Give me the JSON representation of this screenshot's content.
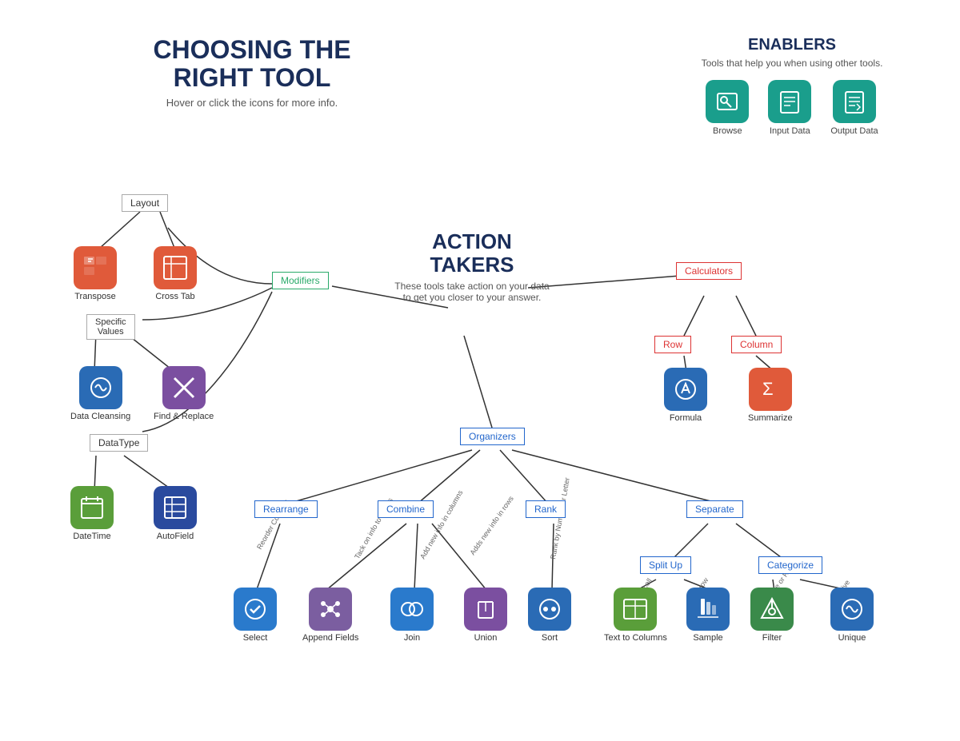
{
  "title": {
    "heading": "CHOOSING THE RIGHT TOOL",
    "subtitle": "Hover or click the icons for more info."
  },
  "enablers": {
    "heading": "ENABLERS",
    "description": "Tools that help you when using other tools.",
    "tools": [
      {
        "label": "Browse",
        "color": "teal",
        "icon": "🔭"
      },
      {
        "label": "Input Data",
        "color": "teal",
        "icon": "📖"
      },
      {
        "label": "Output Data",
        "color": "teal",
        "icon": "📋"
      }
    ]
  },
  "action_takers": {
    "heading": "ACTION TAKERS",
    "description": "These tools take action on your data to get you closer to your answer."
  },
  "categories": {
    "modifiers": "Modifiers",
    "organizers": "Organizers",
    "layout": "Layout",
    "specific_values": "Specific Values",
    "data_type": "DataType",
    "calculators": "Calculators",
    "row": "Row",
    "column": "Column",
    "rearrange": "Rearrange",
    "combine": "Combine",
    "rank": "Rank",
    "separate": "Separate",
    "split_up": "Split Up",
    "categorize": "Categorize"
  },
  "tools": {
    "transpose": "Transpose",
    "cross_tab": "Cross Tab",
    "data_cleansing": "Data Cleansing",
    "find_replace": "Find & Replace",
    "datetime": "DateTime",
    "autofield": "AutoField",
    "formula": "Formula",
    "summarize": "Summarize",
    "select": "Select",
    "append_fields": "Append Fields",
    "join": "Join",
    "union": "Union",
    "sort": "Sort",
    "text_to_columns": "Text to Columns",
    "sample": "Sample",
    "filter": "Filter",
    "unique": "Unique"
  },
  "line_labels": {
    "reorder_columns": "Reorder Columns",
    "tack_on_info_to_values": "Tack on info to values",
    "add_new_info_in_columns": "Add new info in columns",
    "adds_new_info_in_rows": "Adds new info in rows",
    "rank_by_number_or_letter": "Rank by Number or Letter",
    "by_cell": "By cell",
    "by_row": "By row",
    "a_rule_or_range": "A rule or Range",
    "archive": "archive"
  }
}
